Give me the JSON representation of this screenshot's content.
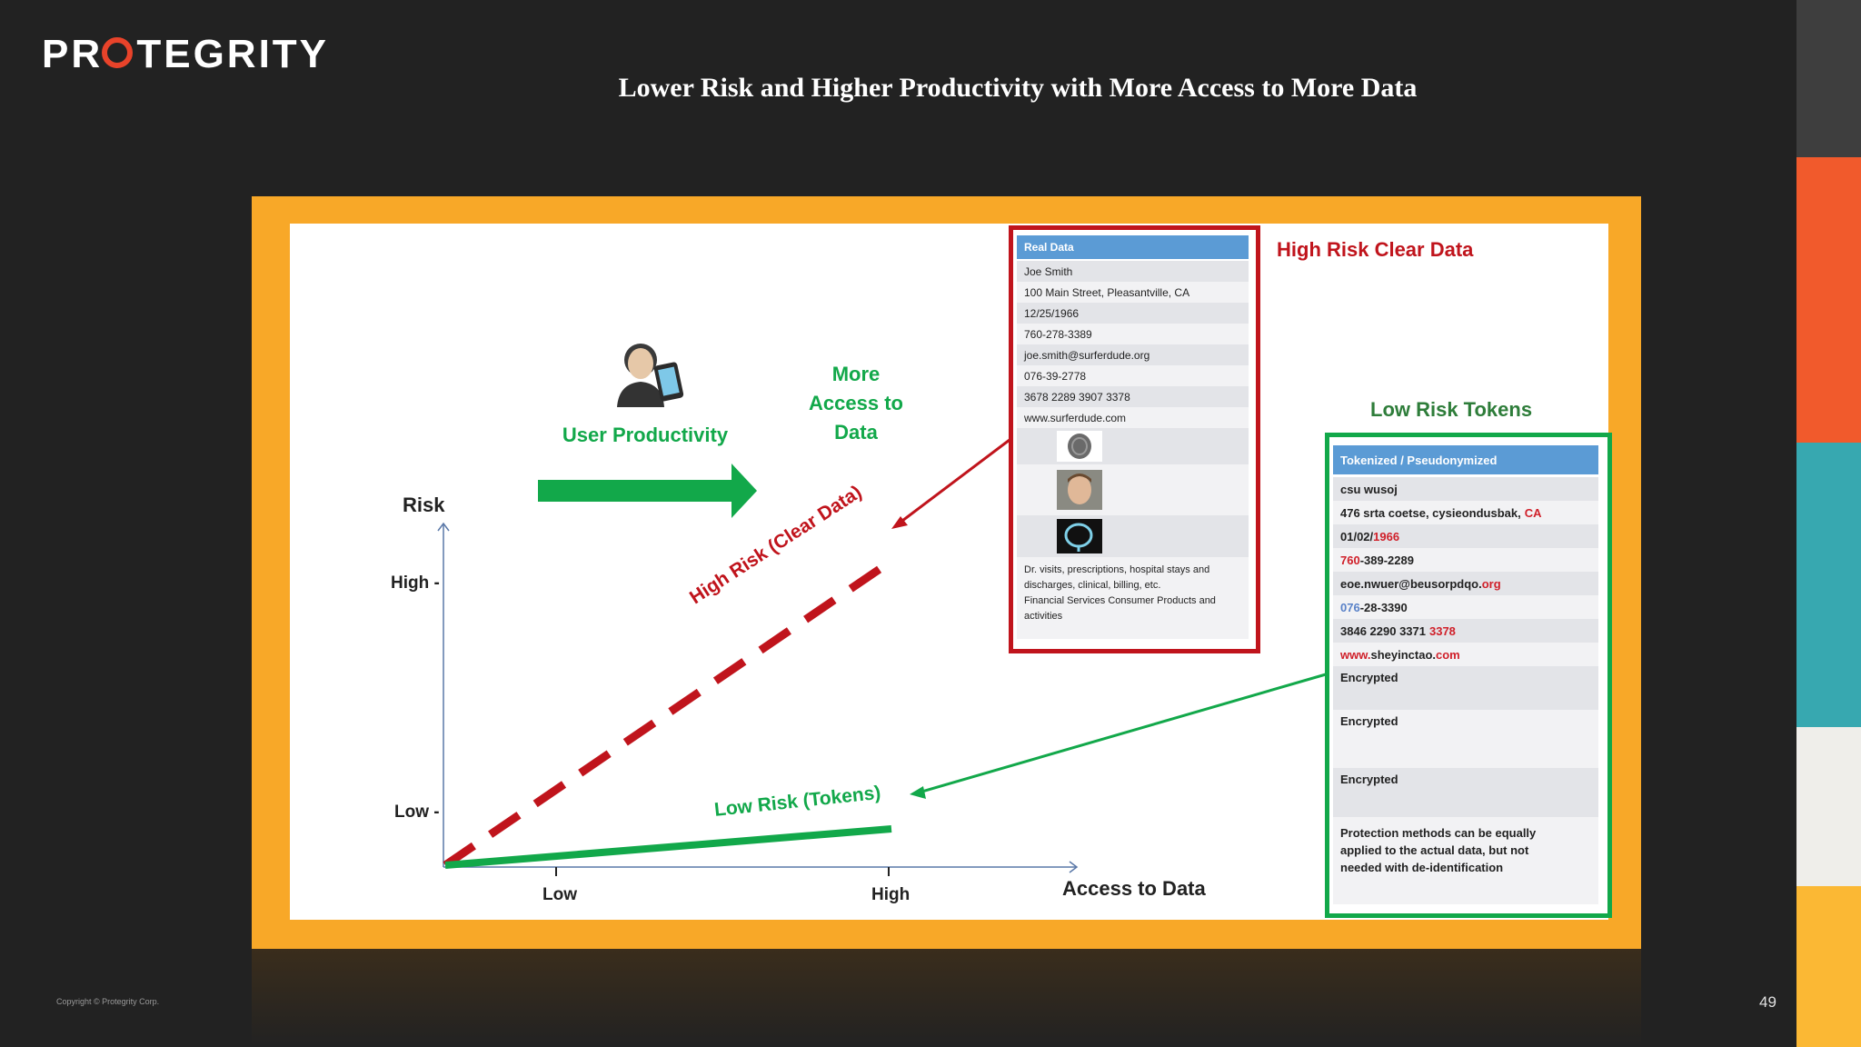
{
  "brand": {
    "logo_text_before": "PR",
    "logo_text_after": "TEGRITY"
  },
  "slide": {
    "title": "Lower Risk and Higher Productivity with More Access to More Data",
    "page_number": "49",
    "copyright": "Copyright © Protegrity Corp."
  },
  "diagram": {
    "user_productivity": "User Productivity",
    "more_access": [
      "More",
      "Access to",
      "Data"
    ],
    "axis_y_title": "Risk",
    "axis_y_high": "High -",
    "axis_y_low": "Low -",
    "axis_x_low": "Low",
    "axis_x_high": "High",
    "axis_x_title": "Access to Data",
    "high_risk_line_label": "High Risk (Clear Data)",
    "low_risk_line_label": "Low Risk (Tokens)"
  },
  "real_data": {
    "heading": "High Risk Clear Data",
    "table_header": "Real Data",
    "rows": [
      "Joe Smith",
      "100 Main Street, Pleasantville, CA",
      "12/25/1966",
      "760-278-3389",
      "joe.smith@surferdude.org",
      "076-39-2778",
      "3678 2289 3907 3378",
      "www.surferdude.com"
    ],
    "footer": [
      "Dr. visits, prescriptions, hospital stays and",
      "discharges,  clinical, billing, etc.",
      "Financial Services Consumer Products and",
      "activities"
    ]
  },
  "tokens": {
    "heading": "Low Risk Tokens",
    "table_header": "Tokenized / Pseudonymized",
    "row_name": "csu wusoj",
    "row_address_a": "476 srta coetse, cysieondusbak, ",
    "row_address_b": "CA",
    "row_date_a": "01/02/",
    "row_date_b": "1966",
    "row_phone_a": "760",
    "row_phone_b": "-389-2289",
    "row_email_a": "eoe.nwuer@beusorpdqo.",
    "row_email_b": "org",
    "row_ssn_a": "076",
    "row_ssn_b": "-28-3390",
    "row_card_a": "3846 2290 3371 ",
    "row_card_b": "3378",
    "row_url_a": "www.",
    "row_url_b": "sheyinctao.",
    "row_url_c": "com",
    "encrypted": [
      "Encrypted",
      "Encrypted",
      "Encrypted"
    ],
    "footer": [
      "Protection methods can be equally",
      "applied to the actual data, but not",
      "needed with de-identification"
    ]
  },
  "colors": {
    "frame": "#f8a828",
    "red": "#c0141c",
    "green": "#12a84a",
    "blue_header": "#5b9bd5",
    "accent_text_green": "#12a84a"
  }
}
